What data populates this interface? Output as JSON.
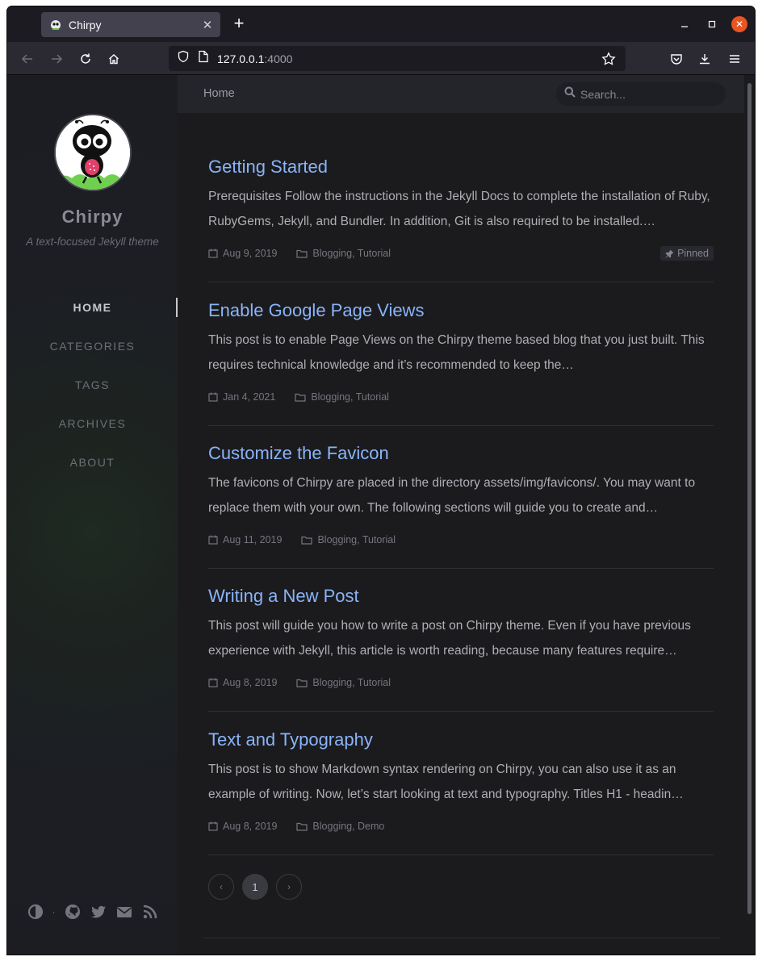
{
  "browser": {
    "tab_title": "Chirpy",
    "url_host": "127.0.0.1",
    "url_port": ":4000"
  },
  "sidebar": {
    "site_title": "Chirpy",
    "site_subtitle": "A text-focused Jekyll theme",
    "nav": [
      {
        "label": "HOME",
        "active": true
      },
      {
        "label": "CATEGORIES",
        "active": false
      },
      {
        "label": "TAGS",
        "active": false
      },
      {
        "label": "ARCHIVES",
        "active": false
      },
      {
        "label": "ABOUT",
        "active": false
      }
    ],
    "bottom_icons": [
      "theme-toggle-icon",
      "github-icon",
      "twitter-icon",
      "email-icon",
      "rss-icon"
    ]
  },
  "topbar": {
    "breadcrumb": "Home",
    "search_placeholder": "Search..."
  },
  "posts": [
    {
      "title": "Getting Started",
      "excerpt": "Prerequisites Follow the instructions in the Jekyll Docs to complete the installation of Ruby, RubyGems, Jekyll, and Bundler. In addition, Git is also required to be installed.…",
      "date": "Aug 9, 2019",
      "categories": "Blogging, Tutorial",
      "pinned_label": "Pinned"
    },
    {
      "title": "Enable Google Page Views",
      "excerpt": "This post is to enable Page Views on the Chirpy theme based blog that you just built. This requires technical knowledge and it’s recommended to keep the…",
      "date": "Jan 4, 2021",
      "categories": "Blogging, Tutorial"
    },
    {
      "title": "Customize the Favicon",
      "excerpt": "The favicons of Chirpy are placed in the directory assets/img/favicons/. You may want to replace them with your own. The following sections will guide you to create and…",
      "date": "Aug 11, 2019",
      "categories": "Blogging, Tutorial"
    },
    {
      "title": "Writing a New Post",
      "excerpt": "This post will guide you how to write a post on Chirpy theme. Even if you have previous experience with Jekyll, this article is worth reading, because many features require…",
      "date": "Aug 8, 2019",
      "categories": "Blogging, Tutorial"
    },
    {
      "title": "Text and Typography",
      "excerpt": "This post is to show Markdown syntax rendering on Chirpy, you can also use it as an example of writing. Now, let’s start looking at text and typography. Titles H1 - headin…",
      "date": "Aug 8, 2019",
      "categories": "Blogging, Demo"
    }
  ],
  "pagination": {
    "prev": "‹",
    "current": "1",
    "next": "›"
  },
  "colors": {
    "link": "#8ab4f8",
    "accent_close": "#e95420",
    "sidebar_bg": "#1c1e24",
    "main_bg": "#1b1b1e"
  }
}
